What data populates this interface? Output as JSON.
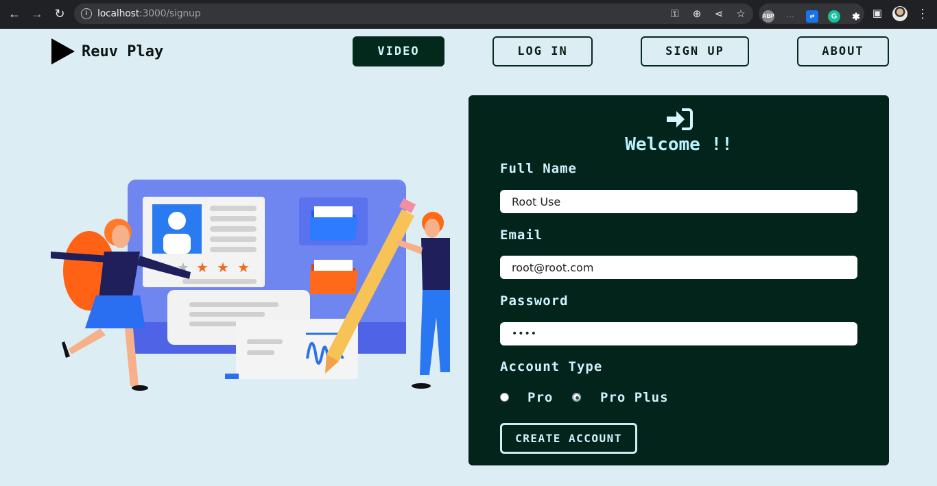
{
  "browser": {
    "url_host": "localhost",
    "url_rest": ":3000/signup",
    "icons": [
      "back-icon",
      "forward-icon",
      "reload-icon",
      "info-icon",
      "key-icon",
      "zoom-icon",
      "share-icon",
      "star-icon",
      "extensions-icon",
      "sidepanel-icon",
      "menu-icon"
    ],
    "extensions": [
      "ABP",
      "G"
    ]
  },
  "header": {
    "brand": "Reuv Play",
    "nav": [
      "VIDEO",
      "LOG IN",
      "SIGN UP",
      "ABOUT"
    ],
    "active_nav": "VIDEO"
  },
  "form": {
    "title": "Welcome !!",
    "fullname_label": "Full Name",
    "fullname_value": "Root Use",
    "email_label": "Email",
    "email_value": "root@root.com",
    "password_label": "Password",
    "password_value": "••••",
    "account_type_label": "Account Type",
    "account_options": [
      "Pro",
      "Pro Plus"
    ],
    "selected_account": "Pro Plus",
    "submit_label": "CREATE ACCOUNT"
  },
  "colors": {
    "page_bg": "#dcedf4",
    "card_bg": "#03241b",
    "accent_text": "#b9f3ff",
    "nav_active_bg": "#03291d"
  }
}
